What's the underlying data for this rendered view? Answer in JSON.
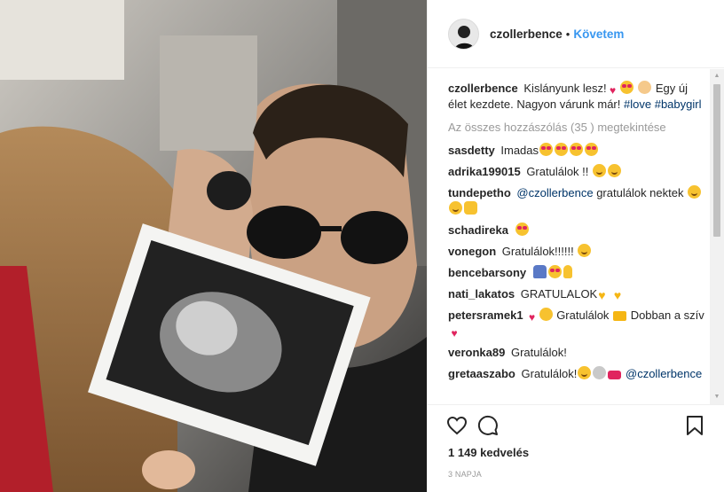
{
  "header": {
    "username": "czollerbence",
    "separator": "•",
    "follow_label": "Követem"
  },
  "caption": {
    "username": "czollerbence",
    "text_a": "Kislányunk lesz!",
    "text_b": "Egy új élet kezdete. Nagyon várunk már!",
    "hashtag_1": "#love",
    "hashtag_2": "#babygirl"
  },
  "view_all": "Az összes hozzászólás (35 ) megtekintése",
  "comments": [
    {
      "user": "sasdetty",
      "text": "Imadas"
    },
    {
      "user": "adrika199015",
      "text": "Gratulálok !!"
    },
    {
      "user": "tundepetho",
      "mention": "@czollerbence",
      "text": "gratulálok nektek"
    },
    {
      "user": "schadireka",
      "text": ""
    },
    {
      "user": "vonegon",
      "text": "Gratulálok!!!!!!"
    },
    {
      "user": "bencebarsony",
      "text": ""
    },
    {
      "user": "nati_lakatos",
      "text": "GRATULALOK"
    },
    {
      "user": "petersramek1",
      "text_a": "Gratulálok",
      "text_b": "Dobban a szív"
    },
    {
      "user": "veronka89",
      "text": "Gratulálok!"
    },
    {
      "user": "gretaaszabo",
      "text": "Gratulálok!",
      "mention": "@czollerbence"
    }
  ],
  "likes": "1 149 kedvelés",
  "timestamp": "3 NAPJA",
  "icons": [
    "heart-icon",
    "comment-icon",
    "bookmark-icon",
    "scroll-up-arrow",
    "scroll-down-arrow"
  ]
}
